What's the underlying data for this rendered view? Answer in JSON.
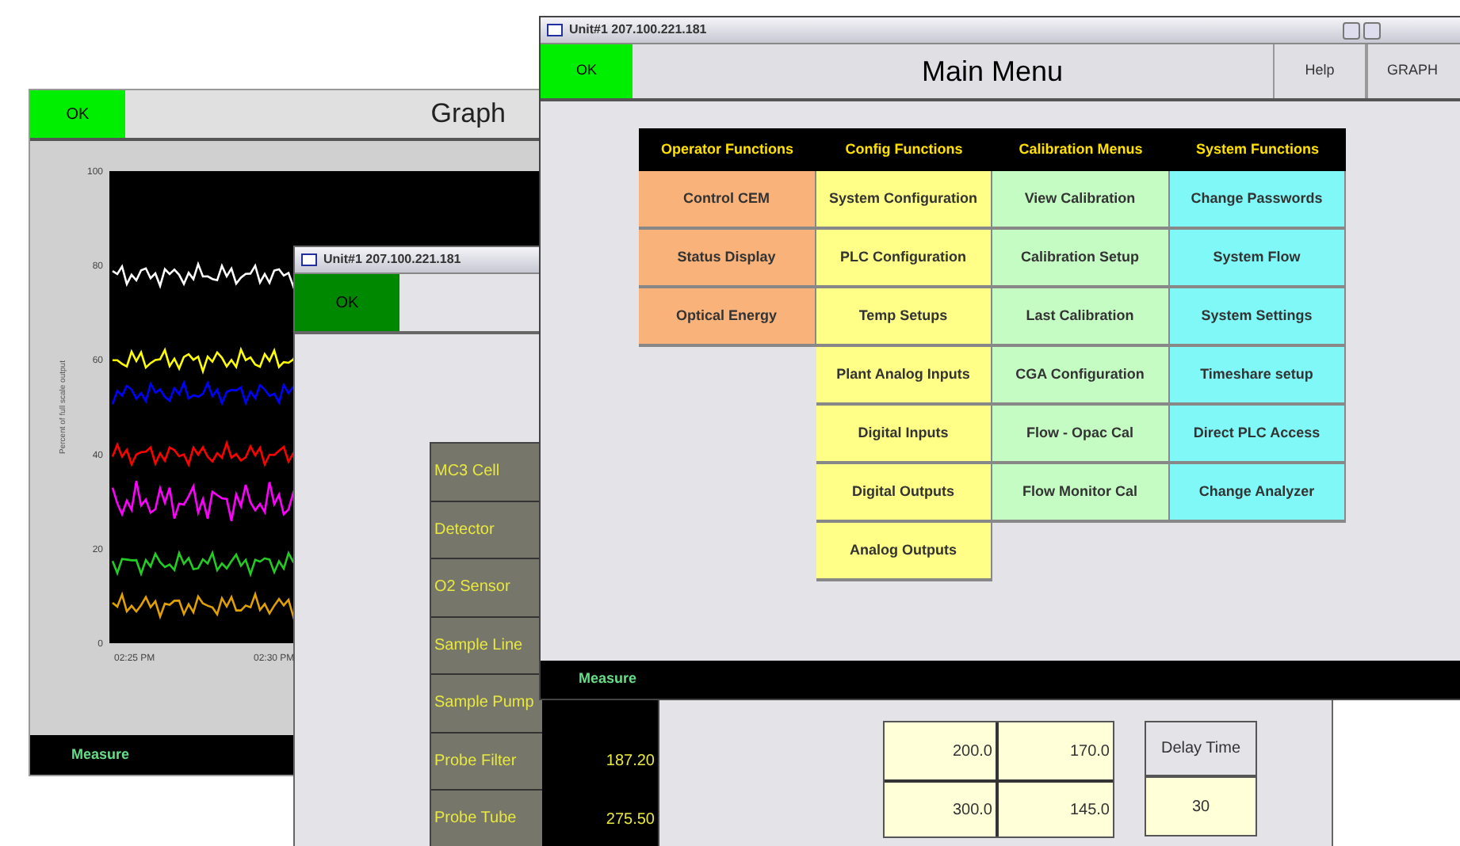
{
  "graph_window": {
    "ok_button": "OK",
    "title": "Graph",
    "chart": {
      "ylabel": "Percent of full scale output",
      "y_ticks": [
        "100",
        "80",
        "60",
        "40",
        "20",
        "0"
      ],
      "x_ticks": [
        "02:25 PM",
        "02:30 PM"
      ],
      "traces": [
        {
          "color": "#ffffff"
        },
        {
          "color": "#ffff00"
        },
        {
          "color": "#0000ff"
        },
        {
          "color": "#ff0000"
        },
        {
          "color": "#ff00ff"
        },
        {
          "color": "#22cc22"
        },
        {
          "color": "#e0a000"
        }
      ]
    },
    "status": "Measure"
  },
  "unit_window": {
    "title": "Unit#1 207.100.221.181",
    "ok_button": "OK",
    "sensors": [
      {
        "label": "MC3 Cell"
      },
      {
        "label": "Detector"
      },
      {
        "label": "O2 Sensor"
      },
      {
        "label": "Sample Line"
      },
      {
        "label": "Sample Pump"
      },
      {
        "label": "Probe Filter",
        "value": "187.20"
      },
      {
        "label": "Probe Tube",
        "value": "275.50"
      }
    ],
    "setpoints": [
      [
        "200.0",
        "170.0"
      ],
      [
        "300.0",
        "145.0"
      ]
    ],
    "delay_time": {
      "label": "Delay Time",
      "value": "30"
    }
  },
  "main_window": {
    "title": "Unit#1 207.100.221.181",
    "ok_button": "OK",
    "heading": "Main Menu",
    "buttons": [
      "Help",
      "GRAPH"
    ],
    "columns": [
      {
        "heading": "Operator Functions",
        "color": "#f9b27a",
        "items": [
          "Control CEM",
          "Status Display",
          "Optical Energy"
        ]
      },
      {
        "heading": "Config Functions",
        "color": "#ffff88",
        "items": [
          "System Configuration",
          "PLC Configuration",
          "Temp Setups",
          "Plant Analog Inputs",
          "Digital Inputs",
          "Digital Outputs",
          "Analog Outputs"
        ]
      },
      {
        "heading": "Calibration Menus",
        "color": "#c4fcc4",
        "items": [
          "View Calibration",
          "Calibration Setup",
          "Last Calibration",
          "CGA Configuration",
          "Flow - Opac Cal",
          "Flow Monitor Cal"
        ]
      },
      {
        "heading": "System Functions",
        "color": "#80f8f8",
        "items": [
          "Change Passwords",
          "System Flow",
          "System Settings",
          "Timeshare setup",
          "Direct PLC Access",
          "Change Analyzer"
        ]
      }
    ],
    "status": "Measure"
  }
}
